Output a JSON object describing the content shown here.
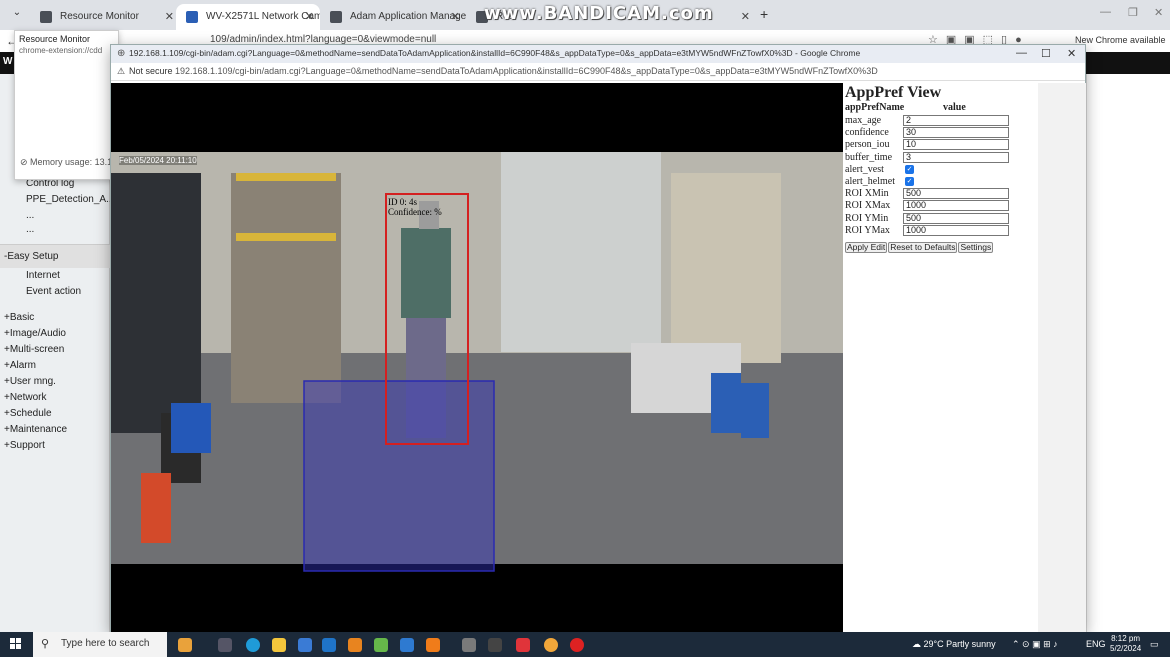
{
  "tabs": [
    {
      "label": "Resource Monitor",
      "active": false
    },
    {
      "label": "WV-X2571L Network Camera",
      "active": true
    },
    {
      "label": "Adam Application Manager",
      "active": false
    },
    {
      "label": "Res",
      "active": false
    }
  ],
  "watermark": "www.BANDICAM.com",
  "bg_toolbar": {
    "url": "109/admin/index.html?language=0&viewmode=null",
    "new_chrome": "New Chrome available"
  },
  "resource_monitor": {
    "title": "Resource Monitor",
    "subtitle": "chrome-extension://cdd",
    "memory": "Memory usage: 13.1"
  },
  "leftmenu": {
    "e_label": "-E",
    "items_top": [
      "Control log",
      "PPE_Detection_A...",
      "...",
      "..."
    ],
    "easy_setup": "-Easy Setup",
    "easy_items": [
      "Internet",
      "Event action"
    ],
    "plus_items": [
      "+Basic",
      "+Image/Audio",
      "+Multi-screen",
      "+Alarm",
      "+User mng.",
      "+Network",
      "+Schedule",
      "+Maintenance",
      "+Support"
    ]
  },
  "popup": {
    "title": "192.168.1.109/cgi-bin/adam.cgi?Language=0&methodName=sendDataToAdamApplication&installId=6C990F48&s_appDataType=0&s_appData=e3tMYW5ndWFnZTowfX0%3D - Google Chrome",
    "not_secure": "Not secure",
    "url": "192.168.1.109/cgi-bin/adam.cgi?Language=0&methodName=sendDataToAdamApplication&installId=6C990F48&s_appDataType=0&s_appData=e3tMYW5ndWFnZTowfX0%3D"
  },
  "video": {
    "timestamp": "Feb/05/2024  20:11:10",
    "detection_id": "ID 0: 4s",
    "detection_conf": "Confidence:  %",
    "colors": {
      "person_box": "#d42020",
      "roi_box": "#2a2ab0"
    }
  },
  "apppref": {
    "title": "AppPref View",
    "col_name": "appPrefName",
    "col_value": "value",
    "rows": [
      {
        "name": "max_age",
        "value": "2",
        "type": "text"
      },
      {
        "name": "confidence",
        "value": "30",
        "type": "text"
      },
      {
        "name": "person_iou",
        "value": "10",
        "type": "text"
      },
      {
        "name": "buffer_time",
        "value": "3",
        "type": "text"
      },
      {
        "name": "alert_vest",
        "value": "checked",
        "type": "checkbox"
      },
      {
        "name": "alert_helmet",
        "value": "checked",
        "type": "checkbox"
      },
      {
        "name": "ROI XMin",
        "value": "500",
        "type": "text"
      },
      {
        "name": "ROI XMax",
        "value": "1000",
        "type": "text"
      },
      {
        "name": "ROI YMin",
        "value": "500",
        "type": "text"
      },
      {
        "name": "ROI YMax",
        "value": "1000",
        "type": "text"
      }
    ],
    "buttons": [
      "Apply Edit",
      "Reset to Defaults",
      "Settings"
    ]
  },
  "taskbar": {
    "search_placeholder": "Type here to search",
    "weather": "29°C  Partly sunny",
    "lang": "ENG",
    "time": "8:12 pm",
    "date": "5/2/2024"
  }
}
